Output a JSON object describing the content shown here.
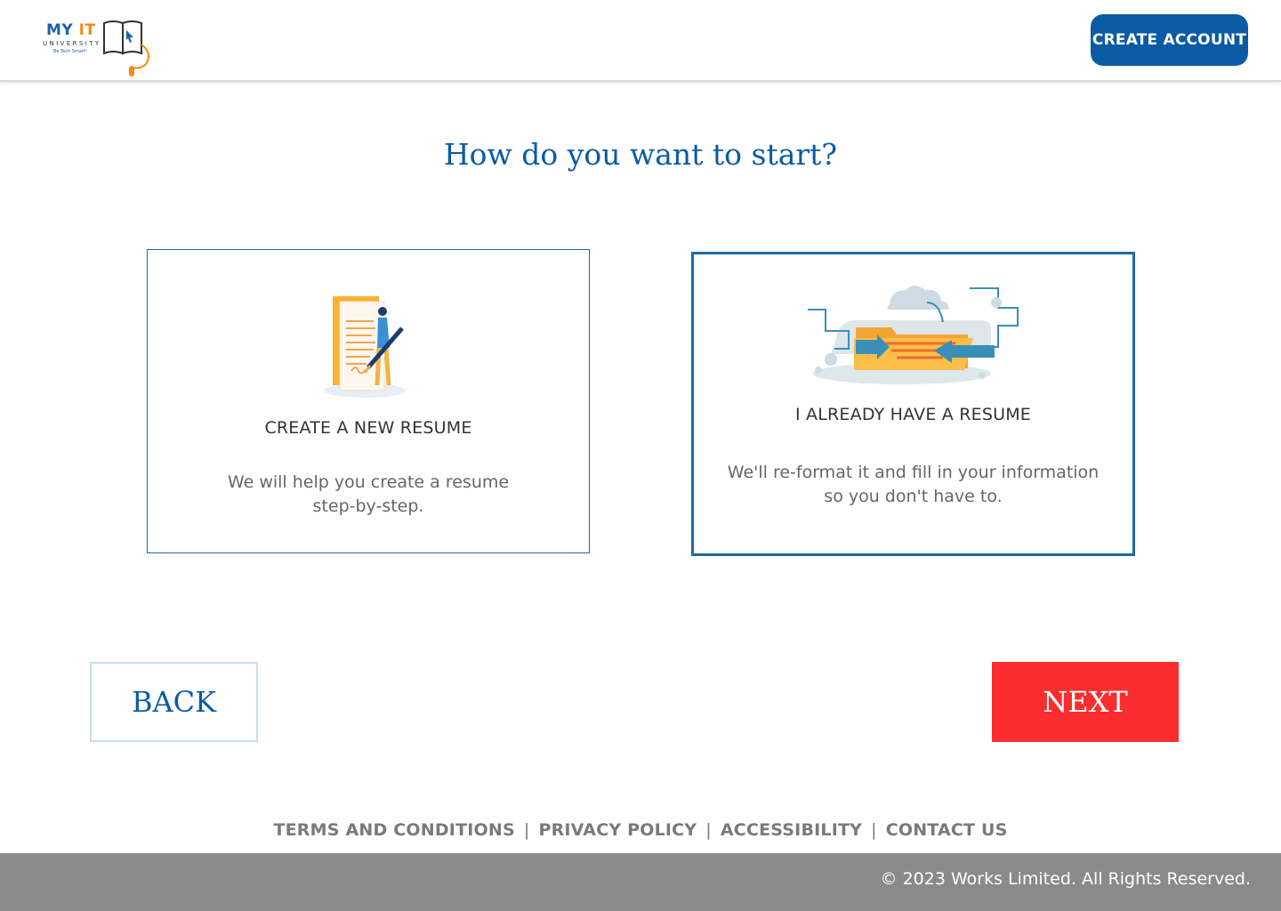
{
  "header": {
    "logo": {
      "line1_my": "MY",
      "line1_it": "IT",
      "line2": "UNIVERSITY",
      "tagline": "Be Tech Smart!"
    },
    "create_account_label": "CREATE ACCOUNT"
  },
  "main": {
    "title": "How do you want to start?",
    "options": [
      {
        "heading": "CREATE A NEW RESUME",
        "description": "We will help you create a resume step-by-step.",
        "icon": "resume-writing-illustration"
      },
      {
        "heading": "I ALREADY HAVE A RESUME",
        "description": "We'll re-format it and fill in your information so you don't have to.",
        "icon": "folder-upload-illustration"
      }
    ],
    "back_label": "BACK",
    "next_label": "NEXT"
  },
  "footer": {
    "links": [
      "TERMS AND CONDITIONS",
      "PRIVACY POLICY",
      "ACCESSIBILITY",
      "CONTACT US"
    ],
    "separator": "|",
    "copyright": "© 2023 Works Limited. All Rights Reserved."
  },
  "colors": {
    "primary_blue": "#0a5ba4",
    "next_red": "#fb2d2f",
    "footer_gray": "#8a8a8a",
    "logo_orange": "#f28a1a"
  }
}
